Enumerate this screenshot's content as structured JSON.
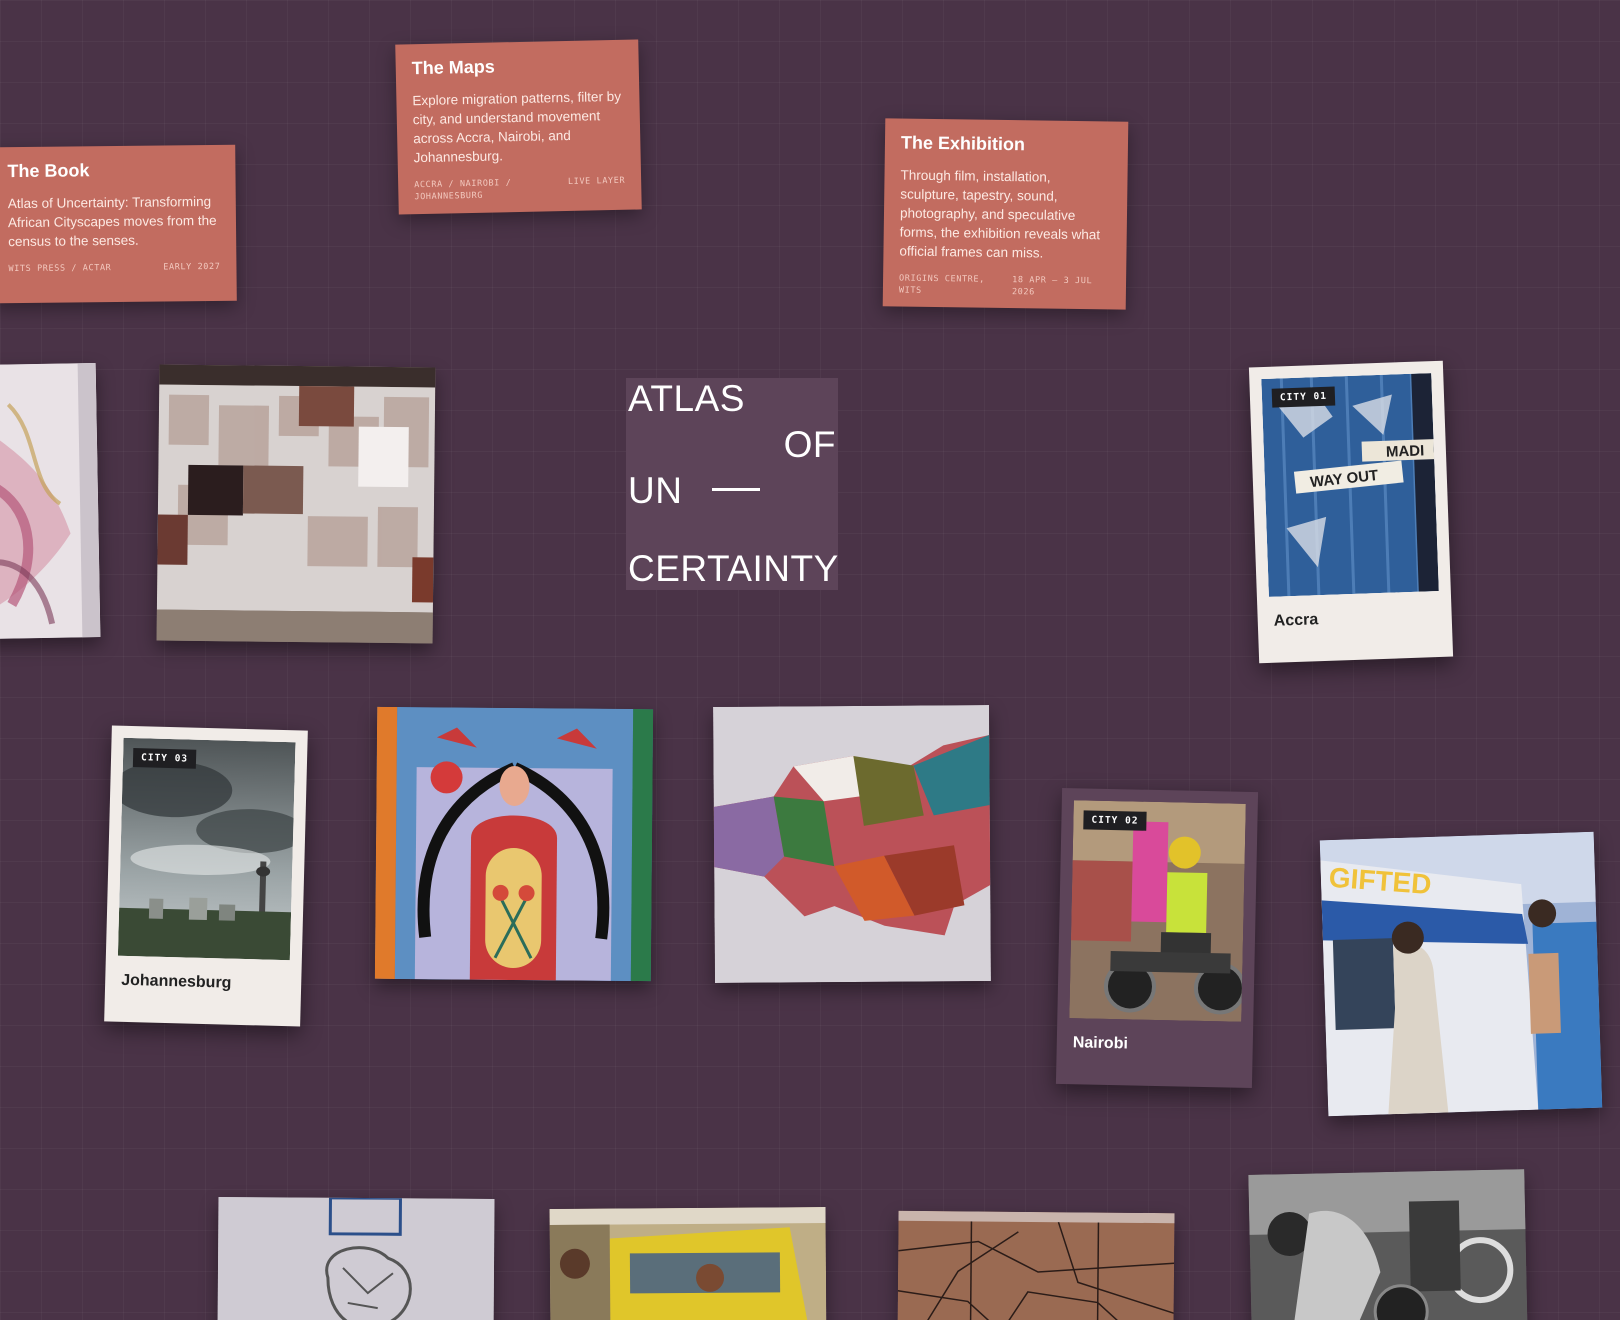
{
  "cards": {
    "book": {
      "title": "The Book",
      "body": "Atlas of Uncertainty: Transforming African Cityscapes moves from the census to the senses.",
      "meta_left": "WITS PRESS / ACTAR",
      "meta_right": "EARLY 2027"
    },
    "maps": {
      "title": "The Maps",
      "body": "Explore migration patterns, filter by city, and understand movement across Accra, Nairobi, and Johannesburg.",
      "meta_left": "ACCRA / NAIROBI / JOHANNESBURG",
      "meta_right": "LIVE LAYER"
    },
    "exhibition": {
      "title": "The Exhibition",
      "body": "Through film, installation, sculpture, tapestry, sound, photography, and speculative forms, the exhibition reveals what official frames can miss.",
      "meta_left": "ORIGINS CENTRE, WITS",
      "meta_right": "18 APR – 3 JUL 2026"
    }
  },
  "title_block": {
    "line1": "ATLAS",
    "line2": "OF",
    "line3": "UN",
    "line4": "CERTAINTY"
  },
  "cities": {
    "accra": {
      "badge": "CITY 01",
      "label": "Accra",
      "sign1": "WAY OUT",
      "sign2": "MADI"
    },
    "nairobi": {
      "badge": "CITY 02",
      "label": "Nairobi"
    },
    "johannesburg": {
      "badge": "CITY 03",
      "label": "Johannesburg"
    }
  },
  "photo_text": {
    "matatu_sign": "GIFTED"
  },
  "colors": {
    "background": "#4a3347",
    "card": "#c26c60",
    "title_block": "#5d4459",
    "polaroid": "#f1ece8"
  }
}
